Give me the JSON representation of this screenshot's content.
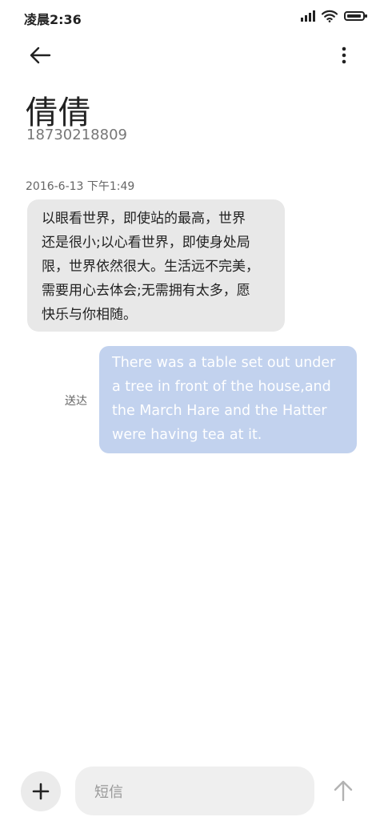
{
  "status_bar": {
    "time": "凌晨2:36",
    "icons": [
      "signal-icon",
      "wifi-icon",
      "battery-icon"
    ]
  },
  "header": {
    "back_icon": "arrow-left-icon",
    "more_icon": "more-vertical-icon"
  },
  "contact": {
    "name": "倩倩",
    "number": "18730218809"
  },
  "conversation": {
    "timestamp": "2016-6-13 下午1:49",
    "incoming": {
      "lines": [
        "以眼看世界，即使站的最高，世界",
        "还是很小;以心看世界，即使身处局",
        "限，世界依然很大。生活远不完美，",
        "需要用心去体会;无需拥有太多，愿",
        "快乐与你相随。"
      ]
    },
    "outgoing": {
      "lines": [
        "There was a table set out under",
        "a tree in front of the house,and",
        "the March Hare and the Hatter",
        "were having tea at it."
      ],
      "status": "送达"
    }
  },
  "composer": {
    "add_icon": "plus-icon",
    "placeholder": "短信",
    "send_icon": "arrow-up-icon"
  },
  "colors": {
    "incoming_bubble": "#e8e8e8",
    "outgoing_bubble": "#c2d2ee",
    "background": "#ffffff"
  }
}
